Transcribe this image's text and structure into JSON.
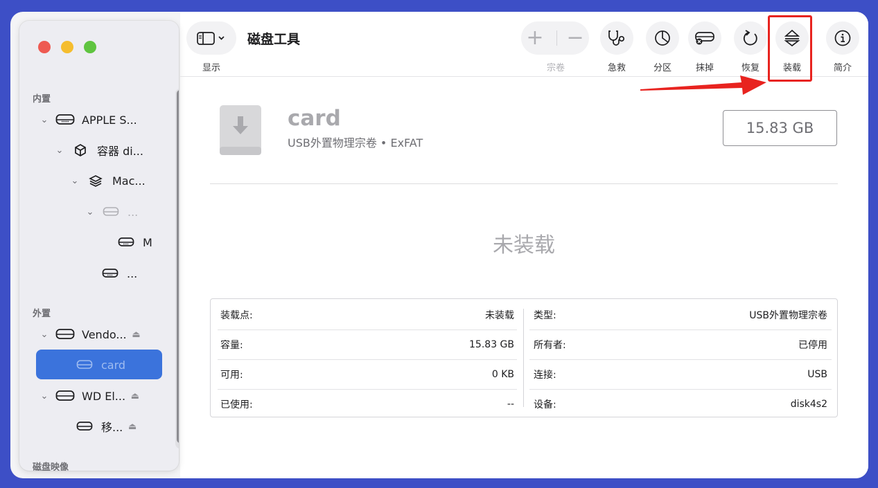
{
  "window": {
    "title": "磁盘工具"
  },
  "toolbar": {
    "view_label": "显示",
    "volume_label": "宗卷",
    "first_aid_label": "急救",
    "partition_label": "分区",
    "erase_label": "抹掉",
    "restore_label": "恢复",
    "mount_label": "装载",
    "info_label": "简介"
  },
  "sidebar": {
    "sections": {
      "internal": "内置",
      "external": "外置",
      "disk_images": "磁盘映像"
    },
    "internal_items": [
      {
        "label": "APPLE S...",
        "icon": "internal-drive-icon"
      },
      {
        "label": "容器 di...",
        "icon": "container-box-icon"
      },
      {
        "label": "Mac...",
        "icon": "volume-layers-icon"
      },
      {
        "label": "...",
        "icon": "drive-dim-icon"
      },
      {
        "label": "M",
        "icon": "drive-icon"
      },
      {
        "label": "...",
        "icon": "drive-icon"
      }
    ],
    "external_items": [
      {
        "label": "Vendo...",
        "icon": "external-drive-icon"
      },
      {
        "label": "card",
        "icon": "drive-icon",
        "selected": true
      },
      {
        "label": "WD El...",
        "icon": "external-drive-icon"
      },
      {
        "label": "移...",
        "icon": "drive-icon"
      }
    ]
  },
  "disk": {
    "name": "card",
    "subtitle": "USB外置物理宗卷 • ExFAT",
    "capacity": "15.83 GB",
    "status": "未装载"
  },
  "info": {
    "left": [
      {
        "key": "装载点:",
        "value": "未装载"
      },
      {
        "key": "容量:",
        "value": "15.83 GB"
      },
      {
        "key": "可用:",
        "value": "0 KB"
      },
      {
        "key": "已使用:",
        "value": "--"
      }
    ],
    "right": [
      {
        "key": "类型:",
        "value": "USB外置物理宗卷"
      },
      {
        "key": "所有者:",
        "value": "已停用"
      },
      {
        "key": "连接:",
        "value": "USB"
      },
      {
        "key": "设备:",
        "value": "disk4s2"
      }
    ]
  },
  "colors": {
    "accent": "#3b73dc",
    "annotation": "#e8231f",
    "background": "#3d4fc6"
  }
}
